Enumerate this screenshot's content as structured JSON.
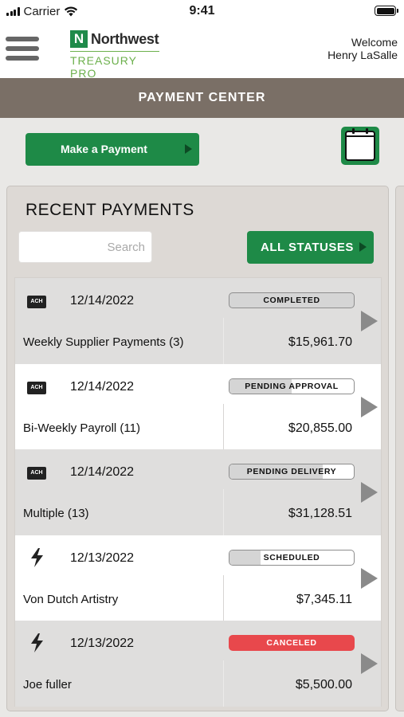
{
  "status_bar": {
    "carrier": "Carrier",
    "time": "9:41"
  },
  "header": {
    "logo_word": "Northwest",
    "logo_letter": "N",
    "logo_sub": "TREASURY PRO",
    "welcome_line1": "Welcome",
    "welcome_line2": "Henry LaSalle"
  },
  "page_title": "PAYMENT CENTER",
  "actions": {
    "make_payment": "Make a Payment"
  },
  "recent": {
    "title": "RECENT PAYMENTS",
    "search_placeholder": "Search",
    "status_filter": "ALL STATUSES",
    "payments": [
      {
        "type": "ACH",
        "date": "12/14/2022",
        "status": "COMPLETED",
        "status_progress": 1.0,
        "description": "Weekly Supplier Payments (3)",
        "amount": "$15,961.70"
      },
      {
        "type": "ACH",
        "date": "12/14/2022",
        "status": "PENDING APPROVAL",
        "status_progress": 0.5,
        "description": "Bi-Weekly Payroll (11)",
        "amount": "$20,855.00"
      },
      {
        "type": "ACH",
        "date": "12/14/2022",
        "status": "PENDING DELIVERY",
        "status_progress": 0.75,
        "description": "Multiple (13)",
        "amount": "$31,128.51"
      },
      {
        "type": "wire",
        "date": "12/13/2022",
        "status": "SCHEDULED",
        "status_progress": 0.25,
        "description": "Von Dutch Artistry",
        "amount": "$7,345.11"
      },
      {
        "type": "wire",
        "date": "12/13/2022",
        "status": "CANCELED",
        "status_progress": 1.0,
        "description": "Joe fuller",
        "amount": "$5,500.00"
      }
    ]
  },
  "colors": {
    "brand_green": "#1e8a47",
    "title_band": "#7a6f66",
    "canceled_red": "#e8484c",
    "logo_green": "#6cb04c"
  }
}
